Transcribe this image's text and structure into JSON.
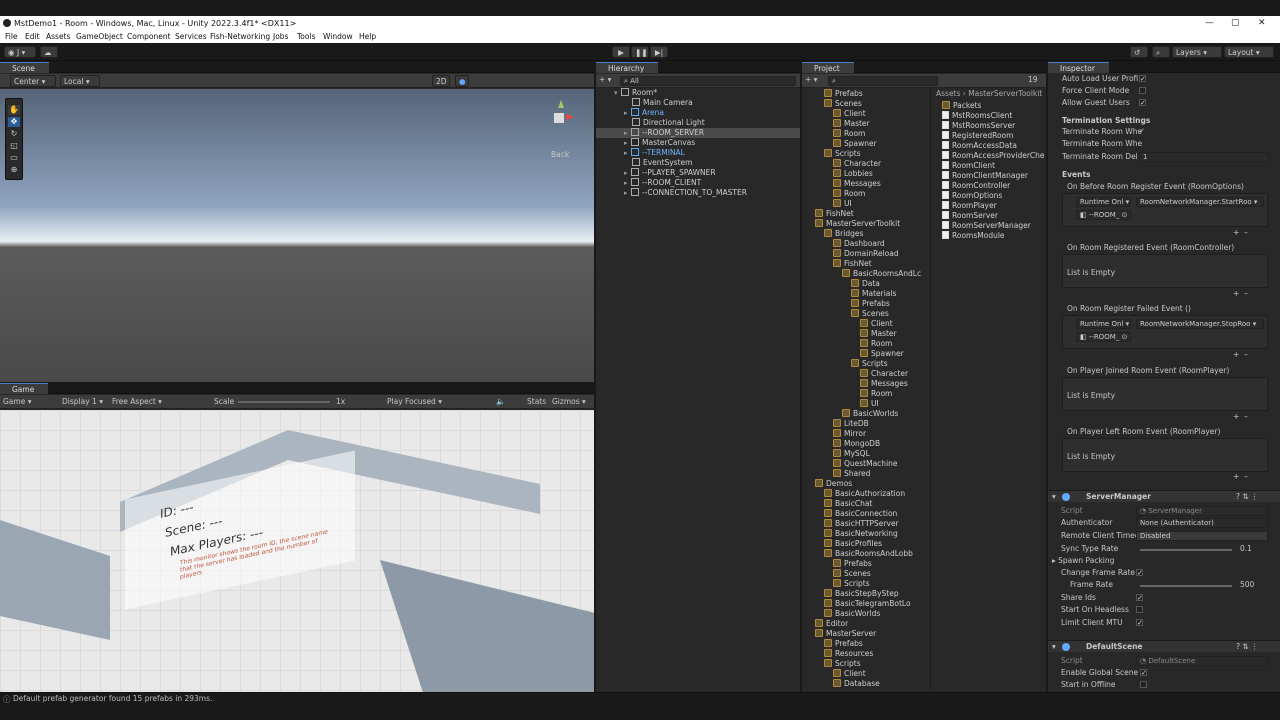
{
  "window": {
    "title": "MstDemo1 - Room - Windows, Mac, Linux - Unity 2022.3.4f1* <DX11>"
  },
  "menu": [
    "File",
    "Edit",
    "Assets",
    "GameObject",
    "Component",
    "Services",
    "Fish-Networking",
    "Jobs",
    "Tools",
    "Window",
    "Help"
  ],
  "toolbar": {
    "account": "J",
    "layers": "Layers",
    "layout": "Layout"
  },
  "scene": {
    "tab": "Scene",
    "pivot": "Center",
    "space": "Local",
    "mode2d": "2D",
    "back": "Back"
  },
  "game": {
    "tab": "Game",
    "view": "Game",
    "display": "Display 1",
    "aspect": "Free Aspect",
    "scale_label": "Scale",
    "scale_value": "1x",
    "play_focused": "Play Focused",
    "stats": "Stats",
    "gizmos": "Gizmos",
    "sign_id": "ID: ---",
    "sign_scene": "Scene: ---",
    "sign_max": "Max Players: ---",
    "sign_note": "This monitor shows the room ID, the scene name that the server has loaded and the number of players"
  },
  "hierarchy": {
    "tab": "Hierarchy",
    "search_placeholder": "All",
    "root": "Room*",
    "items": [
      "Main Camera",
      "Arena",
      "Directional Light",
      "--ROOM_SERVER",
      "MasterCanvas",
      "--TERMINAL",
      "EventSystem",
      "--PLAYER_SPAWNER",
      "--ROOM_CLIENT",
      "--CONNECTION_TO_MASTER"
    ]
  },
  "project": {
    "tab": "Project",
    "count": "19",
    "tree": [
      "Prefabs",
      "Scenes",
      "Client",
      "Master",
      "Room",
      "Spawner",
      "Scripts",
      "Character",
      "Lobbies",
      "Messages",
      "Room",
      "UI",
      "FishNet",
      "MasterServerToolkit",
      "Bridges",
      "Dashboard",
      "DomainReload",
      "FishNet",
      "BasicRoomsAndLc",
      "Data",
      "Materials",
      "Prefabs",
      "Scenes",
      "Client",
      "Master",
      "Room",
      "Spawner",
      "Scripts",
      "Character",
      "Messages",
      "Room",
      "UI",
      "BasicWorlds",
      "LiteDB",
      "Mirror",
      "MongoDB",
      "MySQL",
      "QuestMachine",
      "Shared",
      "Demos",
      "BasicAuthorization",
      "BasicChat",
      "BasicConnection",
      "BasicHTTPServer",
      "BasicNetworking",
      "BasicProfiles",
      "BasicRoomsAndLobb",
      "Prefabs",
      "Scenes",
      "Scripts",
      "BasicStepByStep",
      "BasicTelegramBotLo",
      "BasicWorlds",
      "Editor",
      "MasterServer",
      "Prefabs",
      "Resources",
      "Scripts",
      "Client",
      "Database"
    ],
    "breadcrumb": [
      "Assets",
      "MasterServerToolkit"
    ],
    "files": [
      "Packets",
      "MstRoomsClient",
      "MstRoomsServer",
      "RegisteredRoom",
      "RoomAccessData",
      "RoomAccessProviderChe",
      "RoomClient",
      "RoomClientManager",
      "RoomController",
      "RoomOptions",
      "RoomPlayer",
      "RoomServer",
      "RoomServerManager",
      "RoomsModule"
    ]
  },
  "inspector": {
    "tab": "Inspector",
    "top_rows": [
      {
        "label": "Auto Load User Profi",
        "checked": true
      },
      {
        "label": "Force Client Mode",
        "checked": false
      },
      {
        "label": "Allow Guest Users",
        "checked": true
      }
    ],
    "termination_header": "Termination Settings",
    "termination_rows": [
      {
        "label": "Terminate Room Whe",
        "value": "✓"
      },
      {
        "label": "Terminate Room Whe",
        "value": ""
      },
      {
        "label": "Terminate Room Del",
        "value": "1"
      }
    ],
    "events_header": "Events",
    "events": [
      {
        "title": "On Before Room Register Event (RoomOptions)",
        "runtime": "Runtime Onl",
        "target": "--ROOM_",
        "method": "RoomNetworkManager.StartRoo"
      },
      {
        "title": "On Room Registered Event (RoomController)",
        "empty": "List is Empty"
      },
      {
        "title": "On Room Register Failed Event ()",
        "runtime": "Runtime Onl",
        "target": "--ROOM_",
        "method": "RoomNetworkManager.StopRoo"
      },
      {
        "title": "On Player Joined Room Event (RoomPlayer)",
        "empty": "List is Empty"
      },
      {
        "title": "On Player Left Room Event (RoomPlayer)",
        "empty": "List is Empty"
      }
    ],
    "server_manager": {
      "title": "ServerManager",
      "script_label": "Script",
      "script_value": "ServerManager",
      "authenticator_label": "Authenticator",
      "authenticator_value": "None (Authenticator)",
      "remote_label": "Remote Client Timec",
      "remote_value": "Disabled",
      "sync_label": "Sync Type Rate",
      "sync_value": "0.1",
      "spawn_label": "Spawn Packing",
      "change_label": "Change Frame Rate",
      "frame_label": "Frame Rate",
      "frame_value": "500",
      "share_label": "Share Ids",
      "headless_label": "Start On Headless",
      "mtu_label": "Limit Client MTU"
    },
    "default_scene": {
      "title": "DefaultScene",
      "script_label": "Script",
      "script_value": "DefaultScene",
      "global_label": "Enable Global Scene",
      "offline_label": "Start in Offline"
    }
  },
  "status": {
    "message": "Default prefab generator found 15 prefabs in 293ms."
  },
  "colors": {
    "accent": "#4a7fc7",
    "panel": "#282828",
    "sky_top": "#5a6a80",
    "ground": "#4a4a4a"
  }
}
